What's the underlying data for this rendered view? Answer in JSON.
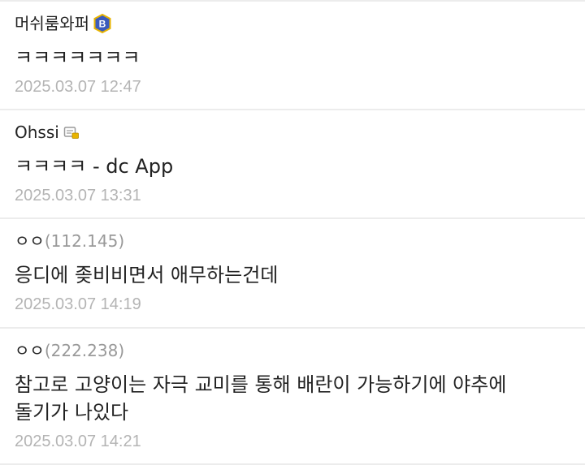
{
  "comments": [
    {
      "author": "머쉬룸와퍼",
      "author_badge": "B",
      "body": "ㅋㅋㅋㅋㅋㅋㅋ",
      "date": "2025.03.07 12:47"
    },
    {
      "author": "Ohssi",
      "author_badge_icon": "gallery-member-icon",
      "body": "ㅋㅋㅋㅋ - dc App",
      "date": "2025.03.07 13:31"
    },
    {
      "author": "ㅇㅇ",
      "ip": "(112.145)",
      "body": "응디에 좆비비면서 애무하는건데",
      "date": "2025.03.07 14:19"
    },
    {
      "author": "ㅇㅇ",
      "ip": "(222.238)",
      "body": "참고로 고양이는 자극 교미를 통해 배란이 가능하기에 야추에 돌기가 나있다",
      "date": "2025.03.07 14:21"
    }
  ],
  "colors": {
    "text": "#222222",
    "meta": "#b4b4b4",
    "ip": "#999999",
    "separator": "#ececec",
    "badge_blue": "#3b5bbd",
    "badge_gold": "#e8b400"
  }
}
